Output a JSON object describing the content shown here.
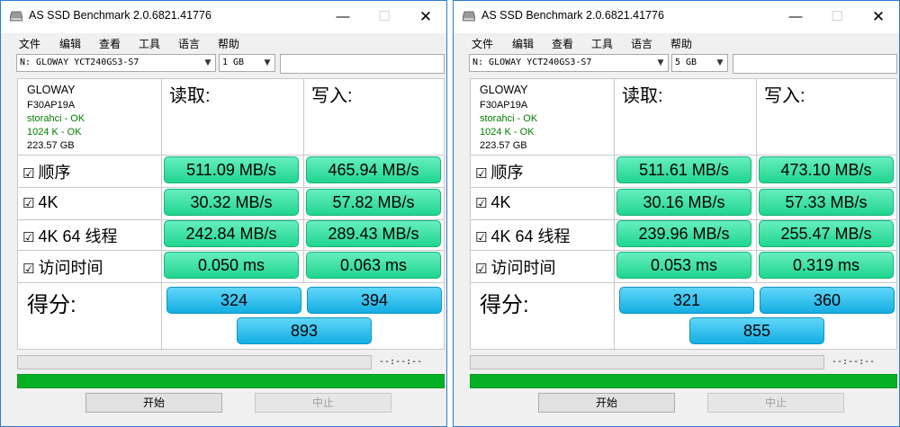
{
  "windows": [
    {
      "title": "AS SSD Benchmark 2.0.6821.41776",
      "menu": [
        "文件",
        "编辑",
        "查看",
        "工具",
        "语言",
        "帮助"
      ],
      "drive": "N: GLOWAY YCT240GS3-S7",
      "size": "1 GB",
      "info": {
        "model": "GLOWAY",
        "firmware": "F30AP19A",
        "driver": "storahci - OK",
        "align": "1024 K - OK",
        "capacity": "223.57 GB"
      },
      "headers": {
        "read": "读取:",
        "write": "写入:"
      },
      "rows": [
        {
          "label": "顺序",
          "read": "511.09 MB/s",
          "write": "465.94 MB/s"
        },
        {
          "label": "4K",
          "read": "30.32 MB/s",
          "write": "57.82 MB/s"
        },
        {
          "label": "4K 64 线程",
          "read": "242.84 MB/s",
          "write": "289.43 MB/s"
        },
        {
          "label": "访问时间",
          "read": "0.050 ms",
          "write": "0.063 ms"
        }
      ],
      "score_label": "得分:",
      "score": {
        "read": "324",
        "write": "394",
        "total": "893"
      },
      "timer": "--:--:--",
      "start": "开始",
      "stop": "中止"
    },
    {
      "title": "AS SSD Benchmark 2.0.6821.41776",
      "menu": [
        "文件",
        "编辑",
        "查看",
        "工具",
        "语言",
        "帮助"
      ],
      "drive": "N: GLOWAY YCT240GS3-S7",
      "size": "5 GB",
      "info": {
        "model": "GLOWAY",
        "firmware": "F30AP19A",
        "driver": "storahci - OK",
        "align": "1024 K - OK",
        "capacity": "223.57 GB"
      },
      "headers": {
        "read": "读取:",
        "write": "写入:"
      },
      "rows": [
        {
          "label": "顺序",
          "read": "511.61 MB/s",
          "write": "473.10 MB/s"
        },
        {
          "label": "4K",
          "read": "30.16 MB/s",
          "write": "57.33 MB/s"
        },
        {
          "label": "4K 64 线程",
          "read": "239.96 MB/s",
          "write": "255.47 MB/s"
        },
        {
          "label": "访问时间",
          "read": "0.053 ms",
          "write": "0.319 ms"
        }
      ],
      "score_label": "得分:",
      "score": {
        "read": "321",
        "write": "360",
        "total": "855"
      },
      "timer": "--:--:--",
      "start": "开始",
      "stop": "中止"
    }
  ],
  "colors": {
    "green_result": "#20d58e",
    "blue_score": "#14aee3",
    "progress_green": "#06b025"
  }
}
